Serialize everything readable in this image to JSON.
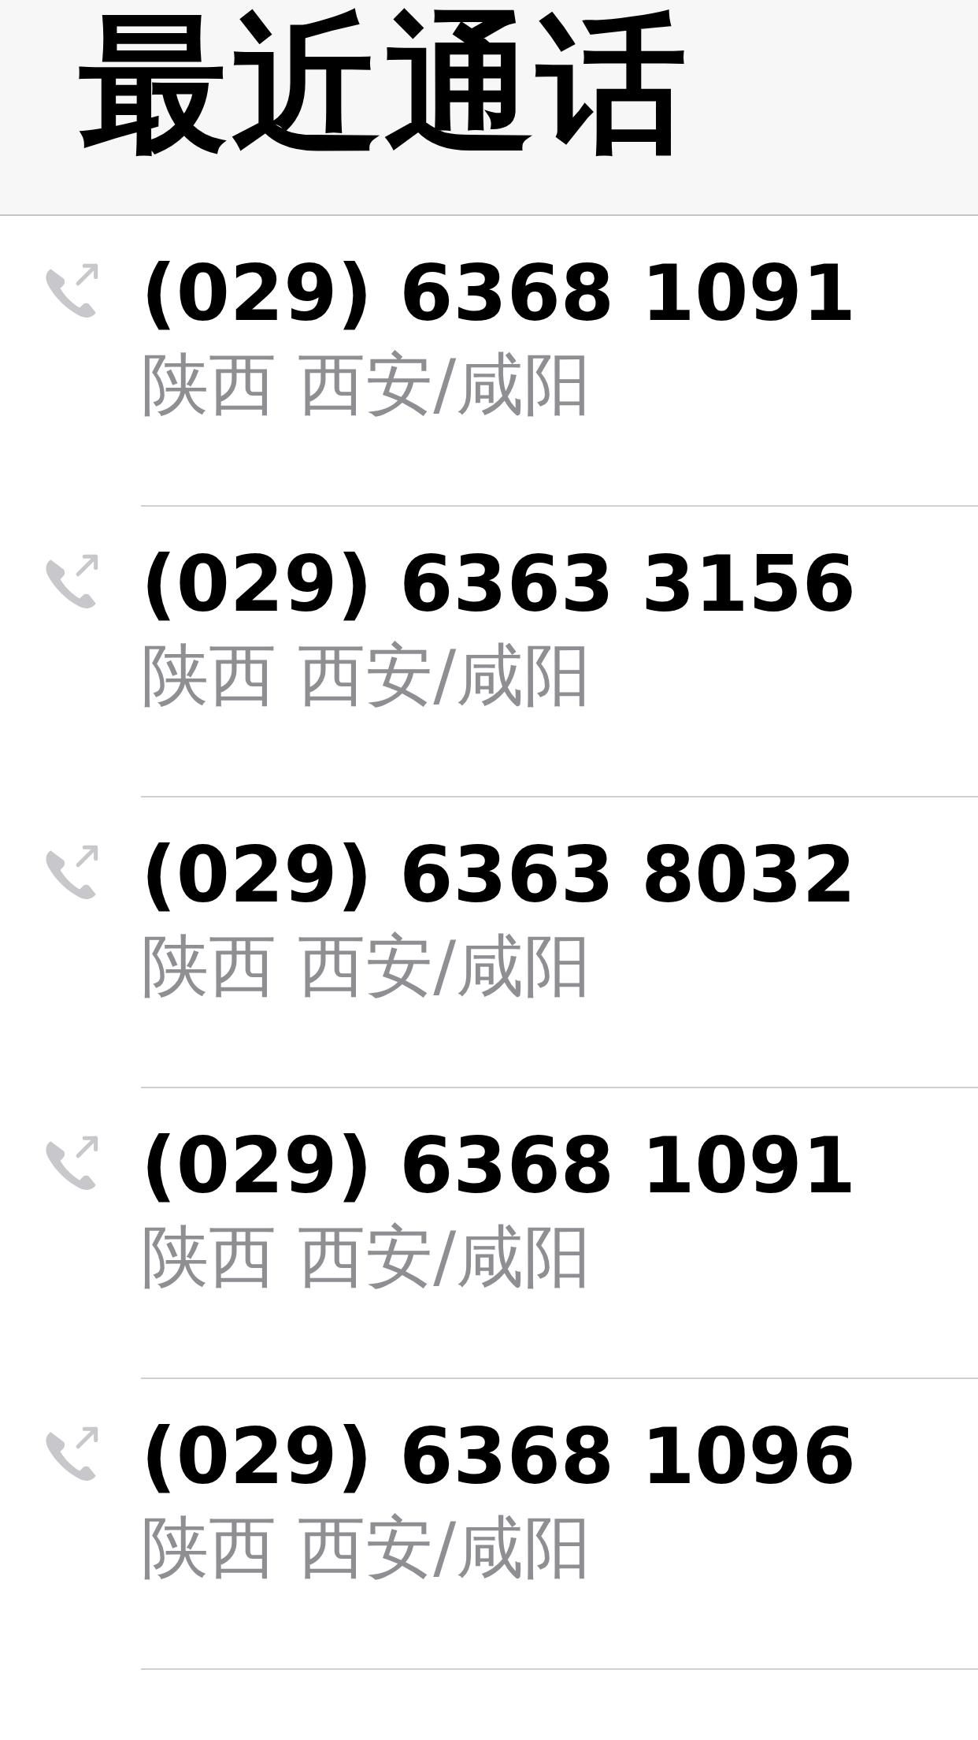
{
  "header": {
    "title": "最近通话"
  },
  "calls": [
    {
      "kind": "outgoing",
      "number": "(029) 6368 1091",
      "location": "陕西 西安/咸阳"
    },
    {
      "kind": "outgoing",
      "number": "(029) 6363 3156",
      "location": "陕西 西安/咸阳"
    },
    {
      "kind": "outgoing",
      "number": "(029) 6363 8032",
      "location": "陕西 西安/咸阳"
    },
    {
      "kind": "outgoing",
      "number": "(029) 6368 1091",
      "location": "陕西 西安/咸阳"
    },
    {
      "kind": "outgoing",
      "number": "(029) 6368 1096",
      "location": "陕西 西安/咸阳"
    }
  ]
}
